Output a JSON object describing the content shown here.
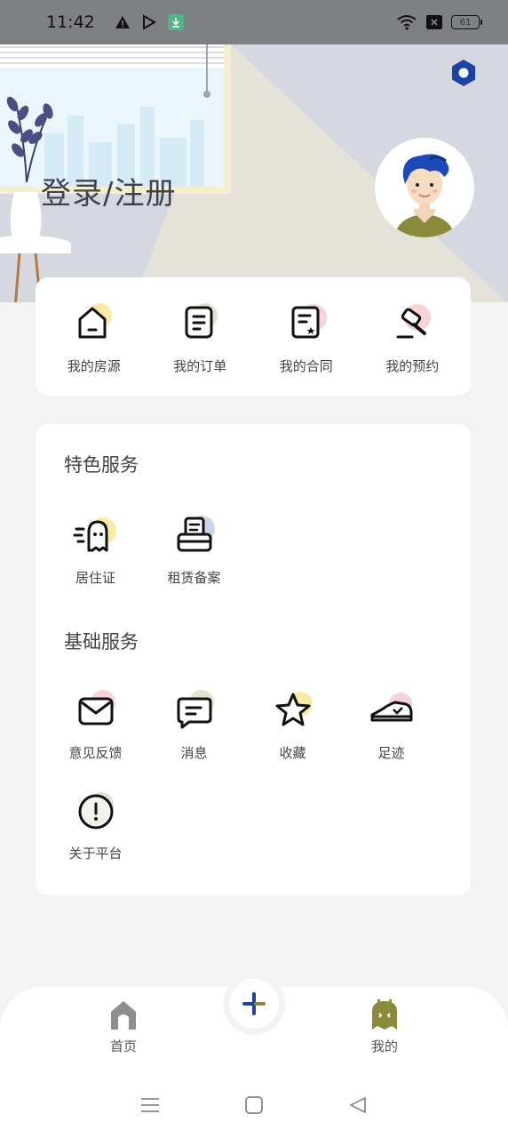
{
  "status_bar": {
    "time": "11:42",
    "battery": "61"
  },
  "profile": {
    "login_label": "登录/注册"
  },
  "quick_actions": [
    {
      "label": "我的房源",
      "icon": "house-icon",
      "color": "#fbe9a6"
    },
    {
      "label": "我的订单",
      "icon": "order-icon",
      "color": "#dfe3cf"
    },
    {
      "label": "我的合同",
      "icon": "contract-icon",
      "color": "#f8d3dc"
    },
    {
      "label": "我的预约",
      "icon": "gavel-icon",
      "color": "#f8d3d3"
    }
  ],
  "featured": {
    "title": "特色服务",
    "items": [
      {
        "label": "居住证",
        "icon": "ghost-icon",
        "color": "#fbe9a6"
      },
      {
        "label": "租赁备案",
        "icon": "printer-icon",
        "color": "#cdd5ee"
      }
    ]
  },
  "basic": {
    "title": "基础服务",
    "items": [
      {
        "label": "意见反馈",
        "icon": "envelope-icon",
        "color": "#f8d3d3"
      },
      {
        "label": "消息",
        "icon": "message-icon",
        "color": "#dfe3cf"
      },
      {
        "label": "收藏",
        "icon": "star-icon",
        "color": "#fbe9a6"
      },
      {
        "label": "足迹",
        "icon": "shoe-icon",
        "color": "#f8d3dc"
      },
      {
        "label": "关于平台",
        "icon": "info-icon",
        "color": "#dfe3cf"
      }
    ]
  },
  "bottom_nav": {
    "home_label": "首页",
    "mine_label": "我的"
  },
  "colors": {
    "accent_blue": "#1a43a8",
    "olive": "#8a8a3a",
    "home_grey": "#8e8e8e"
  }
}
